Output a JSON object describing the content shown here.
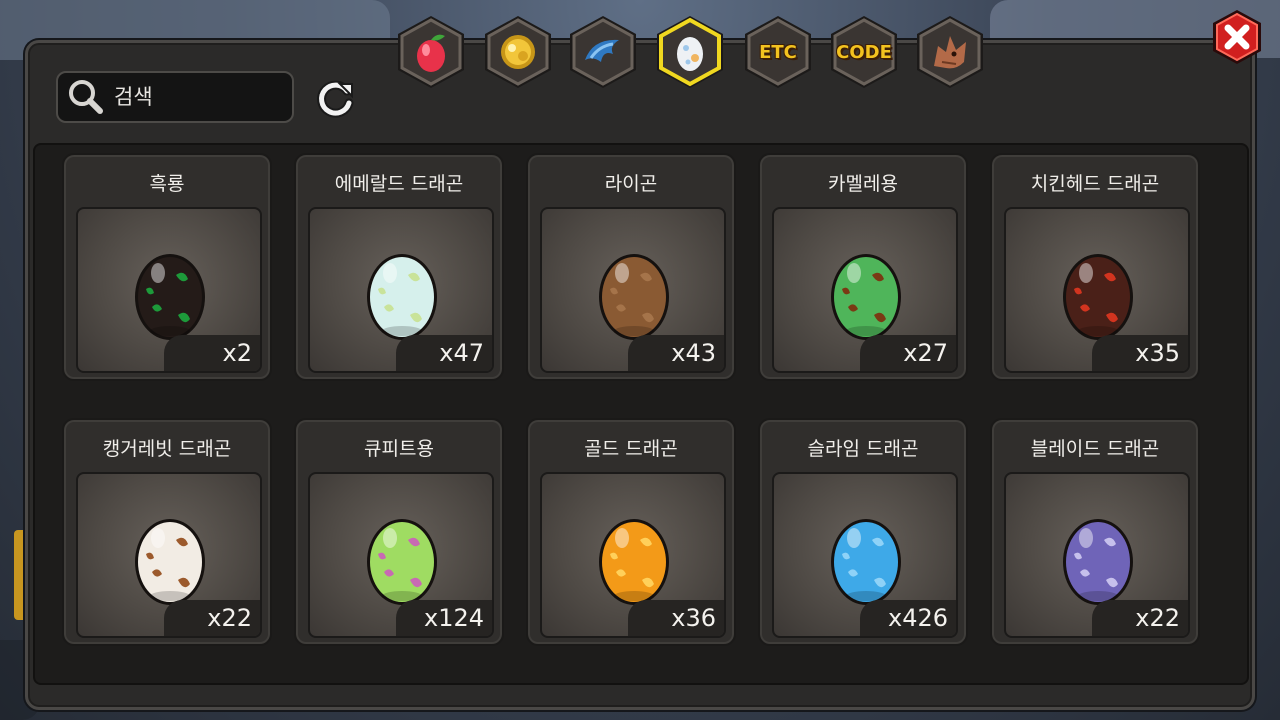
{
  "search": {
    "placeholder": "검색"
  },
  "tabs": [
    {
      "name": "tab-fruit",
      "icon": "fruit-icon",
      "selected": false
    },
    {
      "name": "tab-gold",
      "icon": "gold-coin-icon",
      "selected": false
    },
    {
      "name": "tab-claw",
      "icon": "claw-icon",
      "selected": false
    },
    {
      "name": "tab-egg",
      "icon": "egg-icon",
      "selected": true
    },
    {
      "name": "tab-etc",
      "label": "ETC",
      "selected": false
    },
    {
      "name": "tab-code",
      "label": "CODE",
      "selected": false
    },
    {
      "name": "tab-dragon",
      "icon": "dragon-icon",
      "selected": false
    }
  ],
  "items": [
    {
      "name": "흑룡",
      "count": "x2",
      "egg_base": "#241b18",
      "egg_spot": "#1d9a3a"
    },
    {
      "name": "에메랄드 드래곤",
      "count": "x47",
      "egg_base": "#d6f0ec",
      "egg_spot": "#c9e39a"
    },
    {
      "name": "라이곤",
      "count": "x43",
      "egg_base": "#8a5a33",
      "egg_spot": "#a5744a"
    },
    {
      "name": "카멜레용",
      "count": "x27",
      "egg_base": "#4fb55a",
      "egg_spot": "#7a3a14"
    },
    {
      "name": "치킨헤드 드래곤",
      "count": "x35",
      "egg_base": "#4a2018",
      "egg_spot": "#d2341f"
    },
    {
      "name": "캥거레빗 드래곤",
      "count": "x22",
      "egg_base": "#f2ece4",
      "egg_spot": "#9c5a2c"
    },
    {
      "name": "큐피트용",
      "count": "x124",
      "egg_base": "#9fdc62",
      "egg_spot": "#c86ab3"
    },
    {
      "name": "골드 드래곤",
      "count": "x36",
      "egg_base": "#f39a18",
      "egg_spot": "#ffd05a"
    },
    {
      "name": "슬라임 드래곤",
      "count": "x426",
      "egg_base": "#3ea9e8",
      "egg_spot": "#8fd2f7"
    },
    {
      "name": "블레이드 드래곤",
      "count": "x22",
      "egg_base": "#6f64b8",
      "egg_spot": "#c6c0ec"
    }
  ],
  "colors": {
    "tab_fill": "#3a3532",
    "tab_border": "#6a625b",
    "tab_selected_border": "#f0d820",
    "tab_text": "#f3c21f",
    "close_red": "#d11f1f"
  }
}
